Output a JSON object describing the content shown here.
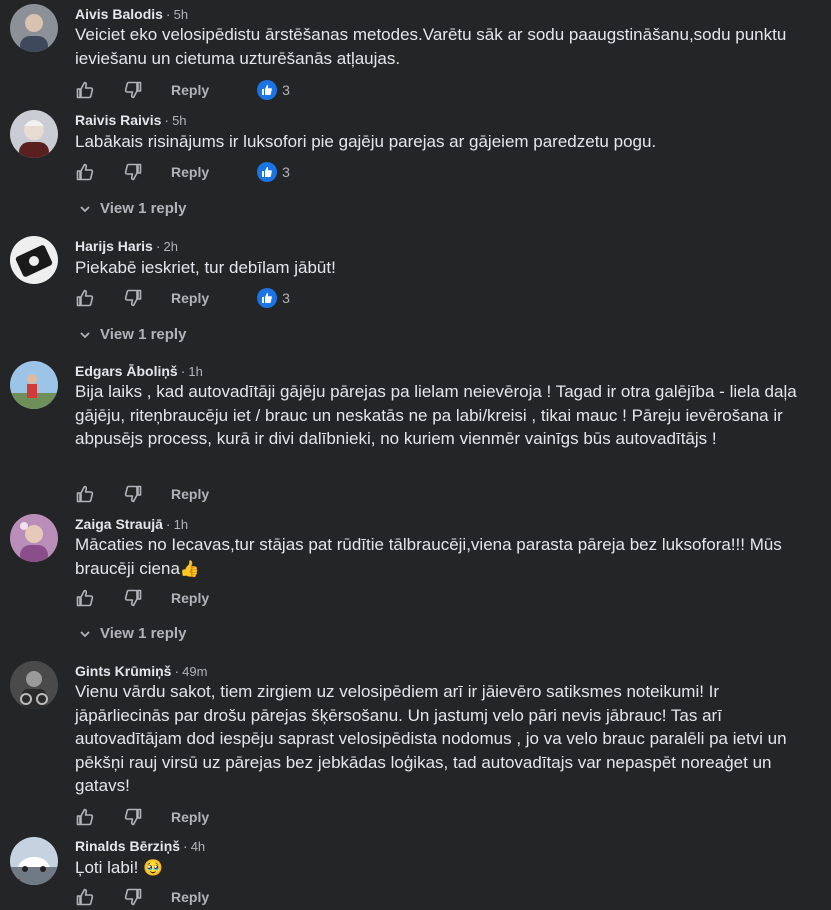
{
  "colors": {
    "background": "#242526",
    "text": "#e4e6eb",
    "muted": "#b0b3b8",
    "reaction_blue": "#1b74e4"
  },
  "icons": {
    "like": "thumbs-up-icon",
    "dislike": "thumbs-down-icon",
    "reaction": "like-reaction-icon",
    "chevron": "chevron-down-icon"
  },
  "actions": {
    "reply_label": "Reply",
    "view_reply_label": "View 1 reply"
  },
  "comments": [
    {
      "name": "Aivis Balodis",
      "time": "5h",
      "text": "Veiciet eko velosipēdistu ārstēšanas metodes.Varētu sāk ar sodu paaugstināšanu,sodu punktu ieviešanu un cietuma uzturēšanās atļaujas.",
      "reactions": "3"
    },
    {
      "name": "Raivis Raivis",
      "time": "5h",
      "text": "Labākais risinājums ir luksofori pie gajēju parejas ar gājeiem paredzetu pogu.",
      "reactions": "3"
    },
    {
      "name": "Harijs Haris",
      "time": "2h",
      "text": "Piekabē ieskriet, tur debīlam jābūt!",
      "reactions": "3"
    },
    {
      "name": "Edgars Āboliņš",
      "time": "1h",
      "text": "Bija laiks , kad autovadītāji gājēju pārejas pa lielam neievēroja ! Tagad ir otra galējība - liela daļa gājēju, riteņbraucēju iet / brauc un neskatās ne pa labi/kreisi , tikai mauc ! Pāreju ievērošana ir abpusējs process, kurā ir divi dalībnieki, no kuriem vienmēr vainīgs būs autovadītājs !"
    },
    {
      "name": "Zaiga Straujā",
      "time": "1h",
      "text": "Mācaties no Iecavas,tur stājas pat rūdītie tālbraucēji,viena parasta pāreja bez luksofora!!! Mūs braucēji ciena",
      "emoji": "👍"
    },
    {
      "name": "Gints Krūmiņš",
      "time": "49m",
      "text": "Vienu vārdu sakot, tiem zirgiem uz velosipēdiem arī ir jāievēro satiksmes noteikumi! Ir jāpārliecinās par drošu pārejas šķērsošanu. Un jastumj velo pāri nevis jābrauc! Tas arī autovadītājam dod iespēju saprast velosipēdista nodomus , jo va velo brauc paralēli pa ietvi un pēkšņi rauj virsū uz pārejas bez jebkādas loģikas, tad autovadītajs var nepaspēt noreaģet un gatavs!"
    },
    {
      "name": "Rinalds Bērziņš",
      "time": "4h",
      "text": "Ļoti labi!",
      "emoji": "🥹"
    }
  ]
}
